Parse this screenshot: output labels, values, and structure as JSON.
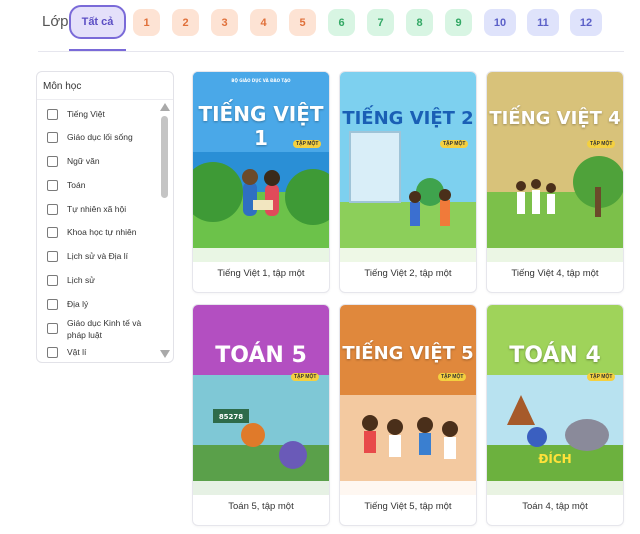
{
  "grade_filter": {
    "label": "Lớp",
    "all_label": "Tất cả",
    "grades": [
      "1",
      "2",
      "3",
      "4",
      "5",
      "6",
      "7",
      "8",
      "9",
      "10",
      "11",
      "12"
    ]
  },
  "subjects_panel": {
    "title": "Môn học",
    "items": [
      "Tiếng Việt",
      "Giáo dục lối sống",
      "Ngữ văn",
      "Toán",
      "Tự nhiên xã hội",
      "Khoa học tự nhiên",
      "Lịch sử và Địa lí",
      "Lịch sử",
      "Địa lý",
      "Giáo dục Kinh tế và pháp luật",
      "Vật lí"
    ]
  },
  "books": [
    {
      "title": "Tiếng Việt 1, tập một",
      "cover_title": "TIẾNG VIỆT 1",
      "volume": "TẬP MỘT",
      "color": "#2a8fd6"
    },
    {
      "title": "Tiếng Việt 2, tập một",
      "cover_title": "TIẾNG VIỆT 2",
      "volume": "TẬP MỘT",
      "color": "#7dd0ef"
    },
    {
      "title": "Tiếng Việt 4, tập một",
      "cover_title": "TIẾNG VIỆT 4",
      "volume": "TẬP MỘT",
      "color": "#d8c27a"
    },
    {
      "title": "Toán 5, tập một",
      "cover_title": "TOÁN 5",
      "volume": "TẬP MỘT",
      "color": "#b34fc1"
    },
    {
      "title": "Tiếng Việt 5, tập một",
      "cover_title": "TIẾNG VIỆT 5",
      "volume": "TẬP MỘT",
      "color": "#e0883c"
    },
    {
      "title": "Toán 4, tập một",
      "cover_title": "TOÁN 4",
      "volume": "TẬP MỘT",
      "color": "#9fd35a"
    }
  ]
}
